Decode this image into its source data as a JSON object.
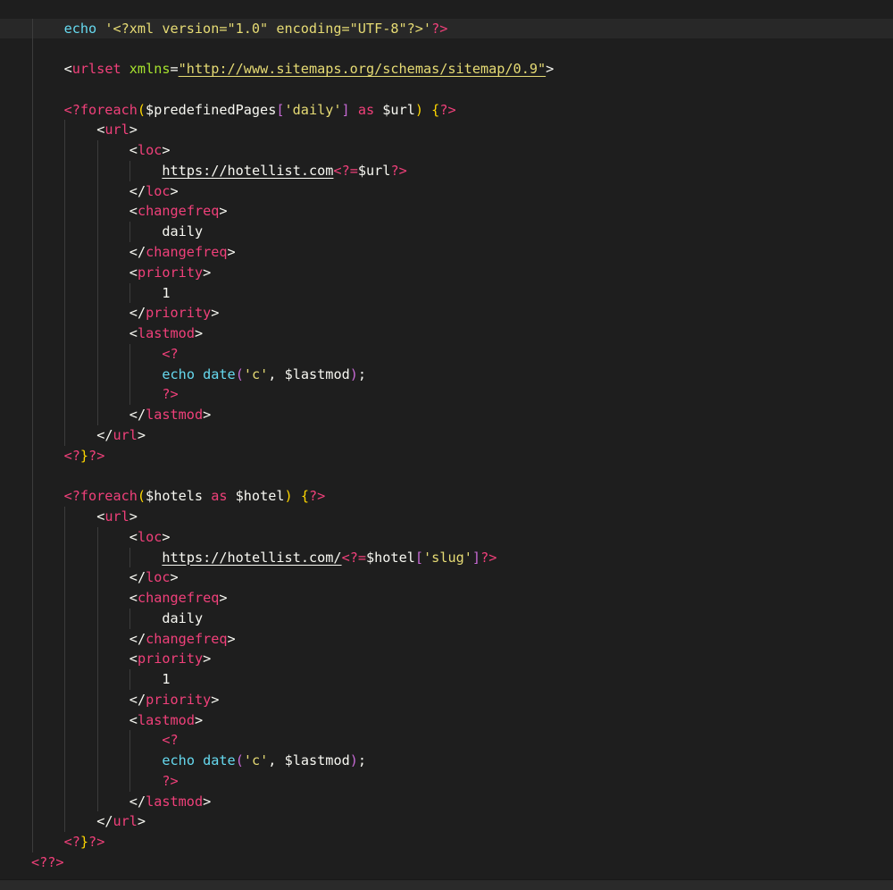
{
  "colors": {
    "background": "#1e1e1e",
    "tag": "#f0407a",
    "keyword": "#66d9ef",
    "string": "#e6db74",
    "attribute": "#a6e22e"
  },
  "current_line": 0,
  "lines": [
    {
      "i": 2,
      "tokens": [
        {
          "k": "c",
          "t": "echo"
        },
        {
          "k": "w",
          "t": " "
        },
        {
          "k": "y",
          "t": "'<?xml version=\"1.0\" encoding=\"UTF-8\"?>'"
        },
        {
          "k": "p",
          "t": "?>"
        }
      ]
    },
    {
      "i": 2,
      "tokens": []
    },
    {
      "i": 2,
      "tokens": [
        {
          "k": "w",
          "t": "<"
        },
        {
          "k": "p",
          "t": "urlset"
        },
        {
          "k": "w",
          "t": " "
        },
        {
          "k": "g",
          "t": "xmlns"
        },
        {
          "k": "w",
          "t": "="
        },
        {
          "k": "uy",
          "t": "\"http://www.sitemaps.org/schemas/sitemap/0.9\""
        },
        {
          "k": "w",
          "t": ">"
        }
      ]
    },
    {
      "i": 2,
      "tokens": []
    },
    {
      "i": 2,
      "tokens": [
        {
          "k": "p",
          "t": "<?foreach"
        },
        {
          "k": "yb",
          "t": "("
        },
        {
          "k": "w",
          "t": "$predefinedPages"
        },
        {
          "k": "v",
          "t": "["
        },
        {
          "k": "y",
          "t": "'daily'"
        },
        {
          "k": "v",
          "t": "]"
        },
        {
          "k": "w",
          "t": " "
        },
        {
          "k": "p",
          "t": "as"
        },
        {
          "k": "w",
          "t": " $url"
        },
        {
          "k": "yb",
          "t": ")"
        },
        {
          "k": "w",
          "t": " "
        },
        {
          "k": "yb",
          "t": "{"
        },
        {
          "k": "p",
          "t": "?>"
        }
      ]
    },
    {
      "i": 3,
      "tokens": [
        {
          "k": "w",
          "t": "<"
        },
        {
          "k": "p",
          "t": "url"
        },
        {
          "k": "w",
          "t": ">"
        }
      ]
    },
    {
      "i": 4,
      "tokens": [
        {
          "k": "w",
          "t": "<"
        },
        {
          "k": "p",
          "t": "loc"
        },
        {
          "k": "w",
          "t": ">"
        }
      ]
    },
    {
      "i": 5,
      "tokens": [
        {
          "k": "u",
          "t": "https://hotellist.com"
        },
        {
          "k": "p",
          "t": "<?="
        },
        {
          "k": "w",
          "t": "$url"
        },
        {
          "k": "p",
          "t": "?>"
        }
      ]
    },
    {
      "i": 4,
      "tokens": [
        {
          "k": "w",
          "t": "</"
        },
        {
          "k": "p",
          "t": "loc"
        },
        {
          "k": "w",
          "t": ">"
        }
      ]
    },
    {
      "i": 4,
      "tokens": [
        {
          "k": "w",
          "t": "<"
        },
        {
          "k": "p",
          "t": "changefreq"
        },
        {
          "k": "w",
          "t": ">"
        }
      ]
    },
    {
      "i": 5,
      "tokens": [
        {
          "k": "w",
          "t": "daily"
        }
      ]
    },
    {
      "i": 4,
      "tokens": [
        {
          "k": "w",
          "t": "</"
        },
        {
          "k": "p",
          "t": "changefreq"
        },
        {
          "k": "w",
          "t": ">"
        }
      ]
    },
    {
      "i": 4,
      "tokens": [
        {
          "k": "w",
          "t": "<"
        },
        {
          "k": "p",
          "t": "priority"
        },
        {
          "k": "w",
          "t": ">"
        }
      ]
    },
    {
      "i": 5,
      "tokens": [
        {
          "k": "w",
          "t": "1"
        }
      ]
    },
    {
      "i": 4,
      "tokens": [
        {
          "k": "w",
          "t": "</"
        },
        {
          "k": "p",
          "t": "priority"
        },
        {
          "k": "w",
          "t": ">"
        }
      ]
    },
    {
      "i": 4,
      "tokens": [
        {
          "k": "w",
          "t": "<"
        },
        {
          "k": "p",
          "t": "lastmod"
        },
        {
          "k": "w",
          "t": ">"
        }
      ]
    },
    {
      "i": 5,
      "tokens": [
        {
          "k": "p",
          "t": "<?"
        }
      ]
    },
    {
      "i": 5,
      "tokens": [
        {
          "k": "c",
          "t": "echo"
        },
        {
          "k": "w",
          "t": " "
        },
        {
          "k": "c",
          "t": "date"
        },
        {
          "k": "v",
          "t": "("
        },
        {
          "k": "y",
          "t": "'c'"
        },
        {
          "k": "w",
          "t": ", $lastmod"
        },
        {
          "k": "v",
          "t": ")"
        },
        {
          "k": "w",
          "t": ";"
        }
      ]
    },
    {
      "i": 5,
      "tokens": [
        {
          "k": "p",
          "t": "?>"
        }
      ]
    },
    {
      "i": 4,
      "tokens": [
        {
          "k": "w",
          "t": "</"
        },
        {
          "k": "p",
          "t": "lastmod"
        },
        {
          "k": "w",
          "t": ">"
        }
      ]
    },
    {
      "i": 3,
      "tokens": [
        {
          "k": "w",
          "t": "</"
        },
        {
          "k": "p",
          "t": "url"
        },
        {
          "k": "w",
          "t": ">"
        }
      ]
    },
    {
      "i": 2,
      "tokens": [
        {
          "k": "p",
          "t": "<?"
        },
        {
          "k": "yb",
          "t": "}"
        },
        {
          "k": "p",
          "t": "?>"
        }
      ]
    },
    {
      "i": 2,
      "tokens": []
    },
    {
      "i": 2,
      "tokens": [
        {
          "k": "p",
          "t": "<?foreach"
        },
        {
          "k": "yb",
          "t": "("
        },
        {
          "k": "w",
          "t": "$hotels "
        },
        {
          "k": "p",
          "t": "as"
        },
        {
          "k": "w",
          "t": " $hotel"
        },
        {
          "k": "yb",
          "t": ")"
        },
        {
          "k": "w",
          "t": " "
        },
        {
          "k": "yb",
          "t": "{"
        },
        {
          "k": "p",
          "t": "?>"
        }
      ]
    },
    {
      "i": 3,
      "tokens": [
        {
          "k": "w",
          "t": "<"
        },
        {
          "k": "p",
          "t": "url"
        },
        {
          "k": "w",
          "t": ">"
        }
      ]
    },
    {
      "i": 4,
      "tokens": [
        {
          "k": "w",
          "t": "<"
        },
        {
          "k": "p",
          "t": "loc"
        },
        {
          "k": "w",
          "t": ">"
        }
      ]
    },
    {
      "i": 5,
      "tokens": [
        {
          "k": "u",
          "t": "https://hotellist.com/"
        },
        {
          "k": "p",
          "t": "<?="
        },
        {
          "k": "w",
          "t": "$hotel"
        },
        {
          "k": "v",
          "t": "["
        },
        {
          "k": "y",
          "t": "'slug'"
        },
        {
          "k": "v",
          "t": "]"
        },
        {
          "k": "p",
          "t": "?>"
        }
      ]
    },
    {
      "i": 4,
      "tokens": [
        {
          "k": "w",
          "t": "</"
        },
        {
          "k": "p",
          "t": "loc"
        },
        {
          "k": "w",
          "t": ">"
        }
      ]
    },
    {
      "i": 4,
      "tokens": [
        {
          "k": "w",
          "t": "<"
        },
        {
          "k": "p",
          "t": "changefreq"
        },
        {
          "k": "w",
          "t": ">"
        }
      ]
    },
    {
      "i": 5,
      "tokens": [
        {
          "k": "w",
          "t": "daily"
        }
      ]
    },
    {
      "i": 4,
      "tokens": [
        {
          "k": "w",
          "t": "</"
        },
        {
          "k": "p",
          "t": "changefreq"
        },
        {
          "k": "w",
          "t": ">"
        }
      ]
    },
    {
      "i": 4,
      "tokens": [
        {
          "k": "w",
          "t": "<"
        },
        {
          "k": "p",
          "t": "priority"
        },
        {
          "k": "w",
          "t": ">"
        }
      ]
    },
    {
      "i": 5,
      "tokens": [
        {
          "k": "w",
          "t": "1"
        }
      ]
    },
    {
      "i": 4,
      "tokens": [
        {
          "k": "w",
          "t": "</"
        },
        {
          "k": "p",
          "t": "priority"
        },
        {
          "k": "w",
          "t": ">"
        }
      ]
    },
    {
      "i": 4,
      "tokens": [
        {
          "k": "w",
          "t": "<"
        },
        {
          "k": "p",
          "t": "lastmod"
        },
        {
          "k": "w",
          "t": ">"
        }
      ]
    },
    {
      "i": 5,
      "tokens": [
        {
          "k": "p",
          "t": "<?"
        }
      ]
    },
    {
      "i": 5,
      "tokens": [
        {
          "k": "c",
          "t": "echo"
        },
        {
          "k": "w",
          "t": " "
        },
        {
          "k": "c",
          "t": "date"
        },
        {
          "k": "v",
          "t": "("
        },
        {
          "k": "y",
          "t": "'c'"
        },
        {
          "k": "w",
          "t": ", $lastmod"
        },
        {
          "k": "v",
          "t": ")"
        },
        {
          "k": "w",
          "t": ";"
        }
      ]
    },
    {
      "i": 5,
      "tokens": [
        {
          "k": "p",
          "t": "?>"
        }
      ]
    },
    {
      "i": 4,
      "tokens": [
        {
          "k": "w",
          "t": "</"
        },
        {
          "k": "p",
          "t": "lastmod"
        },
        {
          "k": "w",
          "t": ">"
        }
      ]
    },
    {
      "i": 3,
      "tokens": [
        {
          "k": "w",
          "t": "</"
        },
        {
          "k": "p",
          "t": "url"
        },
        {
          "k": "w",
          "t": ">"
        }
      ]
    },
    {
      "i": 2,
      "tokens": [
        {
          "k": "p",
          "t": "<?"
        },
        {
          "k": "yb",
          "t": "}"
        },
        {
          "k": "p",
          "t": "?>"
        }
      ]
    },
    {
      "i": 1,
      "tokens": [
        {
          "k": "p",
          "t": "<??>"
        }
      ]
    }
  ]
}
